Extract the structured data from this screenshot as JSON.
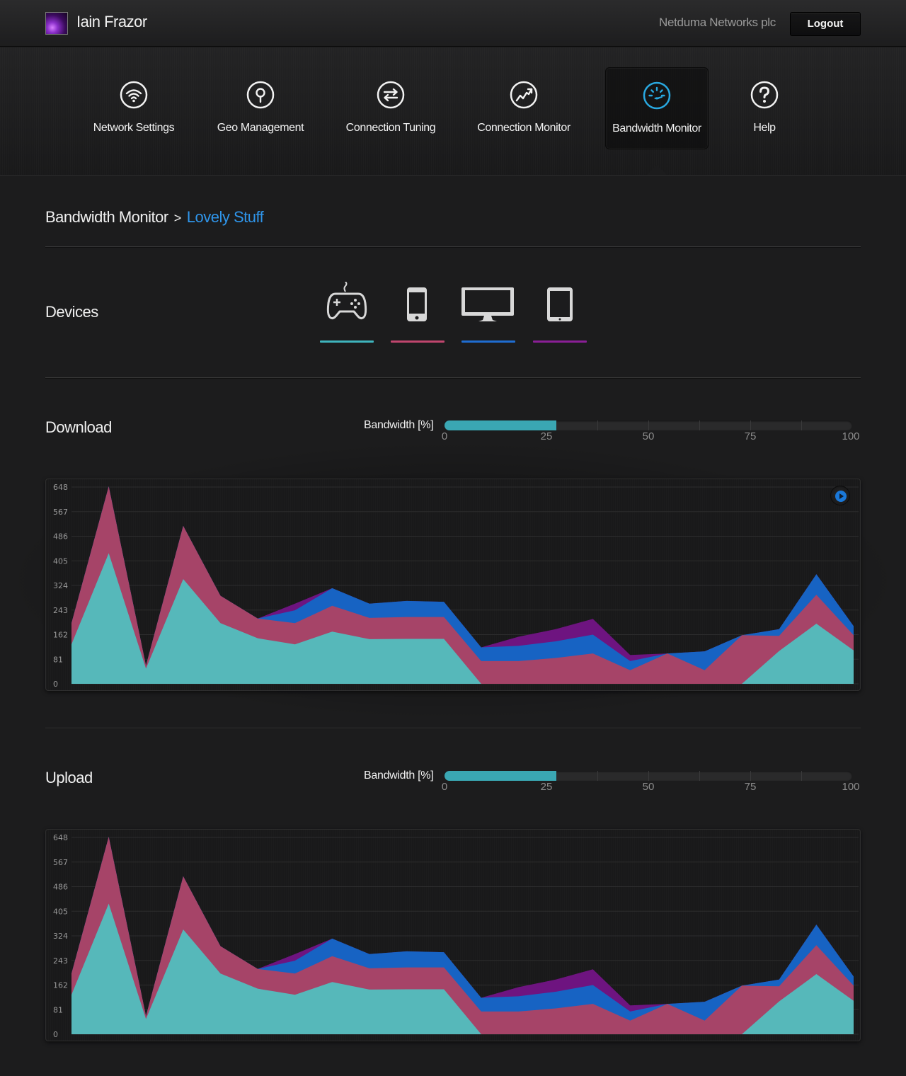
{
  "user": {
    "name": "Iain Frazor"
  },
  "header": {
    "company": "Netduma Networks plc",
    "logout_label": "Logout"
  },
  "nav": {
    "items": [
      {
        "label": "Network Settings",
        "icon": "wifi-icon"
      },
      {
        "label": "Geo Management",
        "icon": "location-pin-icon"
      },
      {
        "label": "Connection Tuning",
        "icon": "arrows-exchange-icon"
      },
      {
        "label": "Connection Monitor",
        "icon": "trend-line-icon"
      },
      {
        "label": "Bandwidth Monitor",
        "icon": "speedometer-icon",
        "active": true
      },
      {
        "label": "Help",
        "icon": "question-icon"
      }
    ],
    "active_color": "#29a8e0"
  },
  "breadcrumb": {
    "root": "Bandwidth Monitor",
    "separator": ">",
    "current": "Lovely Stuff"
  },
  "devices": {
    "title": "Devices",
    "items": [
      {
        "icon": "gamepad-icon",
        "color": "#3fb4bd"
      },
      {
        "icon": "phone-icon",
        "color": "#c0466e"
      },
      {
        "icon": "desktop-icon",
        "color": "#1f6dd1"
      },
      {
        "icon": "tablet-icon",
        "color": "#8a1f96"
      }
    ]
  },
  "download": {
    "title": "Download",
    "bandwidth_label": "Bandwidth [%]",
    "bandwidth_percent": 27.5,
    "scale": [
      "0",
      "25",
      "50",
      "75",
      "100"
    ]
  },
  "upload": {
    "title": "Upload",
    "bandwidth_label": "Bandwidth [%]",
    "bandwidth_percent": 27.5,
    "scale": [
      "0",
      "25",
      "50",
      "75",
      "100"
    ]
  },
  "colors": {
    "teal": "#56b8ba",
    "pink": "#a64468",
    "blue": "#1763c3",
    "purple": "#6e1480"
  },
  "chart_data": [
    {
      "type": "area",
      "stacked": true,
      "yticks": [
        "648",
        "567",
        "486",
        "405",
        "324",
        "243",
        "162",
        "81",
        "0"
      ],
      "ylim": [
        0,
        648
      ],
      "grid": true,
      "series": [
        {
          "values": [
            130,
            430,
            50,
            345,
            200,
            150,
            130,
            172,
            147,
            148,
            148,
            0,
            0,
            0,
            0,
            0,
            0,
            0,
            0,
            108,
            198,
            110
          ]
        },
        {
          "values": [
            70,
            220,
            10,
            175,
            90,
            65,
            70,
            85,
            70,
            72,
            72,
            75,
            75,
            85,
            100,
            45,
            100,
            45,
            160,
            50,
            95,
            50
          ]
        },
        {
          "values": [
            0,
            0,
            0,
            0,
            0,
            0,
            42,
            58,
            47,
            53,
            50,
            45,
            50,
            55,
            62,
            30,
            0,
            62,
            0,
            22,
            68,
            30
          ]
        },
        {
          "values": [
            0,
            0,
            0,
            0,
            0,
            0,
            22,
            0,
            0,
            0,
            0,
            0,
            30,
            40,
            52,
            20,
            0,
            0,
            0,
            0,
            0,
            0
          ]
        }
      ]
    },
    {
      "type": "area",
      "stacked": true,
      "yticks": [
        "648",
        "567",
        "486",
        "405",
        "324",
        "243",
        "162",
        "81",
        "0"
      ],
      "ylim": [
        0,
        648
      ],
      "grid": true,
      "series": [
        {
          "values": [
            130,
            430,
            50,
            345,
            200,
            150,
            130,
            172,
            147,
            148,
            148,
            0,
            0,
            0,
            0,
            0,
            0,
            0,
            0,
            108,
            198,
            110
          ]
        },
        {
          "values": [
            70,
            220,
            10,
            175,
            90,
            65,
            70,
            85,
            70,
            72,
            72,
            75,
            75,
            85,
            100,
            45,
            100,
            45,
            160,
            50,
            95,
            50
          ]
        },
        {
          "values": [
            0,
            0,
            0,
            0,
            0,
            0,
            42,
            58,
            47,
            53,
            50,
            45,
            50,
            55,
            62,
            30,
            0,
            62,
            0,
            22,
            68,
            30
          ]
        },
        {
          "values": [
            0,
            0,
            0,
            0,
            0,
            0,
            22,
            0,
            0,
            0,
            0,
            0,
            30,
            40,
            52,
            20,
            0,
            0,
            0,
            0,
            0,
            0
          ]
        }
      ]
    }
  ]
}
